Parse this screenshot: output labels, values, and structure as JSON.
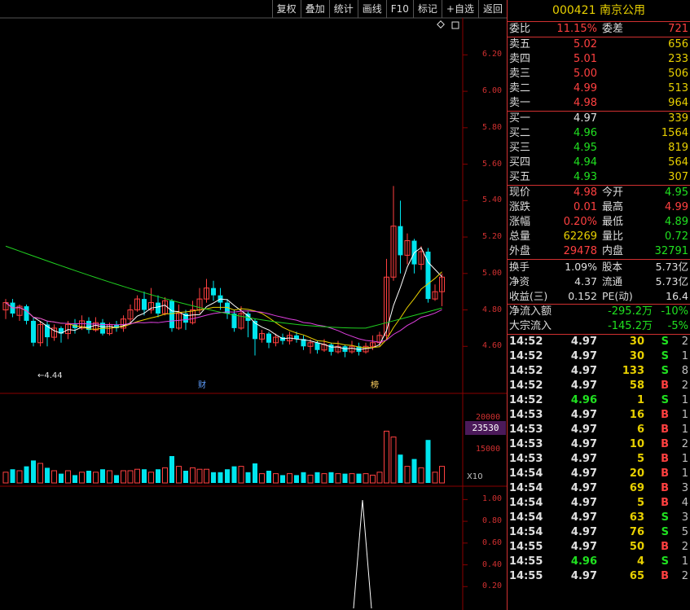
{
  "toolbar": [
    "复权",
    "叠加",
    "统计",
    "画线",
    "F10",
    "标记",
    "+自选",
    "返回"
  ],
  "price_axis": [
    "6.20",
    "6.00",
    "5.80",
    "5.60",
    "5.40",
    "5.20",
    "5.00",
    "4.80",
    "4.60"
  ],
  "volume_axis": [
    "20000",
    "15000"
  ],
  "volume_current": "23530",
  "volume_unit": "X10",
  "indicator_axis": [
    "1.00",
    "0.80",
    "0.60",
    "0.40",
    "0.20"
  ],
  "low_marker": "←4.44",
  "event_tags": [
    {
      "label": "财",
      "color": "#60a0ff"
    },
    {
      "label": "榜",
      "color": "#ffd060"
    }
  ],
  "colors": {
    "up": "#ff4040",
    "down": "#00e5ee",
    "ma5": "#ffffff",
    "ma10": "#e8d000",
    "ma20": "#e040e0",
    "ma60": "#20d020",
    "grid": "#8b0000"
  },
  "stock": {
    "code": "000421",
    "name": "南京公用"
  },
  "order_book": {
    "commission_ratio": {
      "label": "委比",
      "value": "11.15%",
      "diff_label": "委差",
      "diff": "721"
    },
    "sell": [
      {
        "label": "卖五",
        "price": "5.02",
        "vol": "656"
      },
      {
        "label": "卖四",
        "price": "5.01",
        "vol": "233"
      },
      {
        "label": "卖三",
        "price": "5.00",
        "vol": "506"
      },
      {
        "label": "卖二",
        "price": "4.99",
        "vol": "513"
      },
      {
        "label": "卖一",
        "price": "4.98",
        "vol": "964"
      }
    ],
    "buy": [
      {
        "label": "买一",
        "price": "4.97",
        "vol": "339"
      },
      {
        "label": "买二",
        "price": "4.96",
        "vol": "1564"
      },
      {
        "label": "买三",
        "price": "4.95",
        "vol": "819"
      },
      {
        "label": "买四",
        "price": "4.94",
        "vol": "564"
      },
      {
        "label": "买五",
        "price": "4.93",
        "vol": "307"
      }
    ]
  },
  "quote": [
    {
      "l1": "现价",
      "v1": "4.98",
      "c1": "red",
      "l2": "今开",
      "v2": "4.95",
      "c2": "green"
    },
    {
      "l1": "涨跌",
      "v1": "0.01",
      "c1": "red",
      "l2": "最高",
      "v2": "4.99",
      "c2": "red"
    },
    {
      "l1": "涨幅",
      "v1": "0.20%",
      "c1": "red",
      "l2": "最低",
      "v2": "4.89",
      "c2": "green"
    },
    {
      "l1": "总量",
      "v1": "62269",
      "c1": "yellow",
      "l2": "量比",
      "v2": "0.72",
      "c2": "green"
    },
    {
      "l1": "外盘",
      "v1": "29478",
      "c1": "red",
      "l2": "内盘",
      "v2": "32791",
      "c2": "green"
    }
  ],
  "fundamentals": [
    {
      "l1": "换手",
      "v1": "1.09%",
      "l2": "股本",
      "v2": "5.73亿"
    },
    {
      "l1": "净资",
      "v1": "4.37",
      "l2": "流通",
      "v2": "5.73亿"
    },
    {
      "l1": "收益(三)",
      "v1": "0.152",
      "l2": "PE(动)",
      "v2": "16.4"
    }
  ],
  "flows": [
    {
      "label": "净流入额",
      "value": "-295.2万",
      "pct": "-10%"
    },
    {
      "label": "大宗流入",
      "value": "-145.2万",
      "pct": "-5%"
    }
  ],
  "ticks": [
    {
      "time": "14:52",
      "price": "4.97",
      "vol": "30",
      "side": "S",
      "cnt": "2",
      "pc": "white"
    },
    {
      "time": "14:52",
      "price": "4.97",
      "vol": "30",
      "side": "S",
      "cnt": "1",
      "pc": "white"
    },
    {
      "time": "14:52",
      "price": "4.97",
      "vol": "133",
      "side": "S",
      "cnt": "8",
      "pc": "white"
    },
    {
      "time": "14:52",
      "price": "4.97",
      "vol": "58",
      "side": "B",
      "cnt": "2",
      "pc": "white"
    },
    {
      "time": "14:52",
      "price": "4.96",
      "vol": "1",
      "side": "S",
      "cnt": "1",
      "pc": "green"
    },
    {
      "time": "14:53",
      "price": "4.97",
      "vol": "16",
      "side": "B",
      "cnt": "1",
      "pc": "white"
    },
    {
      "time": "14:53",
      "price": "4.97",
      "vol": "6",
      "side": "B",
      "cnt": "1",
      "pc": "white"
    },
    {
      "time": "14:53",
      "price": "4.97",
      "vol": "10",
      "side": "B",
      "cnt": "2",
      "pc": "white"
    },
    {
      "time": "14:53",
      "price": "4.97",
      "vol": "5",
      "side": "B",
      "cnt": "1",
      "pc": "white"
    },
    {
      "time": "14:54",
      "price": "4.97",
      "vol": "20",
      "side": "B",
      "cnt": "1",
      "pc": "white"
    },
    {
      "time": "14:54",
      "price": "4.97",
      "vol": "69",
      "side": "B",
      "cnt": "3",
      "pc": "white"
    },
    {
      "time": "14:54",
      "price": "4.97",
      "vol": "5",
      "side": "B",
      "cnt": "4",
      "pc": "white"
    },
    {
      "time": "14:54",
      "price": "4.97",
      "vol": "63",
      "side": "S",
      "cnt": "3",
      "pc": "white"
    },
    {
      "time": "14:54",
      "price": "4.97",
      "vol": "76",
      "side": "S",
      "cnt": "5",
      "pc": "white"
    },
    {
      "time": "14:55",
      "price": "4.97",
      "vol": "50",
      "side": "B",
      "cnt": "2",
      "pc": "white"
    },
    {
      "time": "14:55",
      "price": "4.96",
      "vol": "4",
      "side": "S",
      "cnt": "1",
      "pc": "green"
    },
    {
      "time": "14:55",
      "price": "4.97",
      "vol": "65",
      "side": "B",
      "cnt": "2",
      "pc": "white"
    }
  ],
  "chart_data": {
    "type": "candlestick",
    "price_range": [
      4.4,
      6.3
    ],
    "candles": [
      [
        4.8,
        4.84,
        4.75,
        4.86
      ],
      [
        4.84,
        4.78,
        4.76,
        4.86
      ],
      [
        4.77,
        4.82,
        4.74,
        4.83
      ],
      [
        4.82,
        4.74,
        4.72,
        4.83
      ],
      [
        4.74,
        4.62,
        4.6,
        4.76
      ],
      [
        4.62,
        4.72,
        4.6,
        4.74
      ],
      [
        4.72,
        4.65,
        4.6,
        4.74
      ],
      [
        4.65,
        4.7,
        4.63,
        4.72
      ],
      [
        4.7,
        4.67,
        4.62,
        4.71
      ],
      [
        4.67,
        4.72,
        4.64,
        4.74
      ],
      [
        4.72,
        4.7,
        4.67,
        4.75
      ],
      [
        4.7,
        4.74,
        4.69,
        4.77
      ],
      [
        4.74,
        4.69,
        4.67,
        4.76
      ],
      [
        4.69,
        4.73,
        4.68,
        4.76
      ],
      [
        4.73,
        4.67,
        4.66,
        4.75
      ],
      [
        4.67,
        4.72,
        4.66,
        4.73
      ],
      [
        4.72,
        4.7,
        4.68,
        4.74
      ],
      [
        4.7,
        4.75,
        4.68,
        4.77
      ],
      [
        4.75,
        4.8,
        4.73,
        4.83
      ],
      [
        4.8,
        4.86,
        4.79,
        4.88
      ],
      [
        4.86,
        4.8,
        4.77,
        4.9
      ],
      [
        4.8,
        4.84,
        4.78,
        4.92
      ],
      [
        4.84,
        4.78,
        4.76,
        4.88
      ],
      [
        4.78,
        4.85,
        4.77,
        4.87
      ],
      [
        4.85,
        4.7,
        4.68,
        4.86
      ],
      [
        4.7,
        4.78,
        4.69,
        4.83
      ],
      [
        4.78,
        4.73,
        4.69,
        4.8
      ],
      [
        4.73,
        4.8,
        4.72,
        4.85
      ],
      [
        4.8,
        4.86,
        4.78,
        4.92
      ],
      [
        4.86,
        4.92,
        4.84,
        4.97
      ],
      [
        4.92,
        4.88,
        4.85,
        4.96
      ],
      [
        4.88,
        4.84,
        4.8,
        4.92
      ],
      [
        4.84,
        4.78,
        4.75,
        4.86
      ],
      [
        4.78,
        4.7,
        4.68,
        4.8
      ],
      [
        4.7,
        4.78,
        4.69,
        4.82
      ],
      [
        4.78,
        4.74,
        4.65,
        4.79
      ],
      [
        4.74,
        4.64,
        4.55,
        4.75
      ],
      [
        4.64,
        4.67,
        4.62,
        4.69
      ],
      [
        4.67,
        4.62,
        4.59,
        4.68
      ],
      [
        4.62,
        4.65,
        4.6,
        4.67
      ],
      [
        4.65,
        4.63,
        4.61,
        4.67
      ],
      [
        4.63,
        4.66,
        4.61,
        4.68
      ],
      [
        4.66,
        4.64,
        4.62,
        4.68
      ],
      [
        4.64,
        4.6,
        4.58,
        4.66
      ],
      [
        4.6,
        4.62,
        4.56,
        4.64
      ],
      [
        4.62,
        4.58,
        4.56,
        4.63
      ],
      [
        4.58,
        4.61,
        4.57,
        4.64
      ],
      [
        4.61,
        4.57,
        4.55,
        4.62
      ],
      [
        4.57,
        4.6,
        4.56,
        4.63
      ],
      [
        4.6,
        4.57,
        4.54,
        4.61
      ],
      [
        4.57,
        4.6,
        4.56,
        4.63
      ],
      [
        4.6,
        4.57,
        4.55,
        4.62
      ],
      [
        4.57,
        4.6,
        4.56,
        4.62
      ],
      [
        4.6,
        4.62,
        4.58,
        4.66
      ],
      [
        4.62,
        4.66,
        4.6,
        4.68
      ],
      [
        4.66,
        4.98,
        4.64,
        5.08
      ],
      [
        4.98,
        5.26,
        4.96,
        5.48
      ],
      [
        5.26,
        5.1,
        5.0,
        5.4
      ],
      [
        5.1,
        5.18,
        5.05,
        5.22
      ],
      [
        5.18,
        5.05,
        5.0,
        5.19
      ],
      [
        5.05,
        5.12,
        5.02,
        5.15
      ],
      [
        5.12,
        4.86,
        4.84,
        5.14
      ],
      [
        4.86,
        4.9,
        4.85,
        4.94
      ],
      [
        4.9,
        4.98,
        4.82,
        5.0
      ]
    ]
  }
}
